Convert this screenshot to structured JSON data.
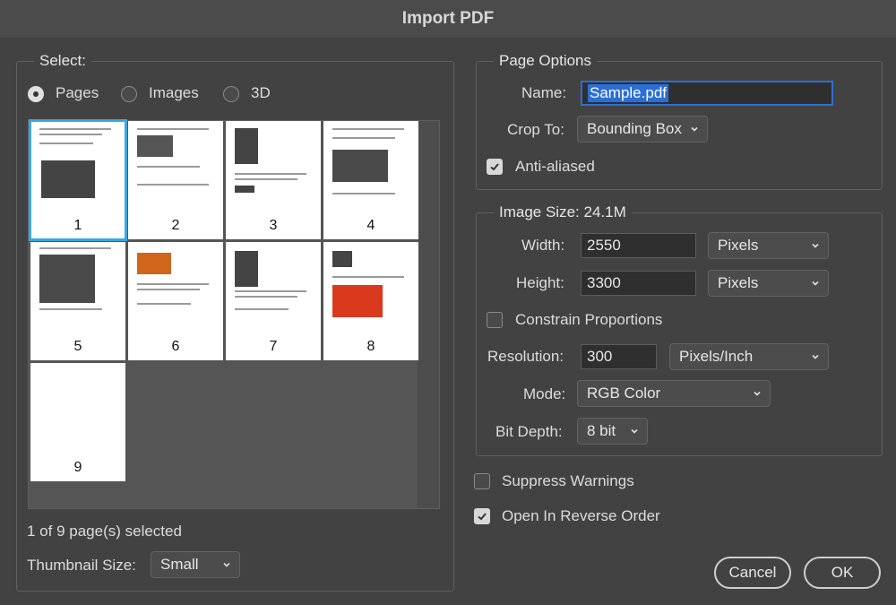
{
  "window": {
    "title": "Import PDF"
  },
  "select": {
    "label": "Select:",
    "options": [
      "Pages",
      "Images",
      "3D"
    ],
    "selected": "Pages",
    "pages": [
      "1",
      "2",
      "3",
      "4",
      "5",
      "6",
      "7",
      "8",
      "9"
    ],
    "selected_page": "1",
    "status": "1 of 9 page(s) selected",
    "thumbnail_size_label": "Thumbnail Size:",
    "thumbnail_size_value": "Small"
  },
  "page_options": {
    "label": "Page Options",
    "name_label": "Name:",
    "name_value": "Sample.pdf",
    "crop_label": "Crop To:",
    "crop_value": "Bounding Box",
    "anti_aliased_label": "Anti-aliased",
    "anti_aliased": true
  },
  "image_size": {
    "label": "Image Size: 24.1M",
    "width_label": "Width:",
    "width_value": "2550",
    "width_unit": "Pixels",
    "height_label": "Height:",
    "height_value": "3300",
    "height_unit": "Pixels",
    "constrain_label": "Constrain Proportions",
    "constrain": false,
    "resolution_label": "Resolution:",
    "resolution_value": "300",
    "resolution_unit": "Pixels/Inch",
    "mode_label": "Mode:",
    "mode_value": "RGB Color",
    "bit_depth_label": "Bit Depth:",
    "bit_depth_value": "8 bit"
  },
  "suppress_warnings_label": "Suppress Warnings",
  "suppress_warnings": false,
  "reverse_order_label": "Open In Reverse Order",
  "reverse_order": true,
  "buttons": {
    "cancel": "Cancel",
    "ok": "OK"
  },
  "colors": {
    "accent": "#2b6fd6",
    "selection_outline": "#3aa7e0",
    "background": "#424242"
  }
}
